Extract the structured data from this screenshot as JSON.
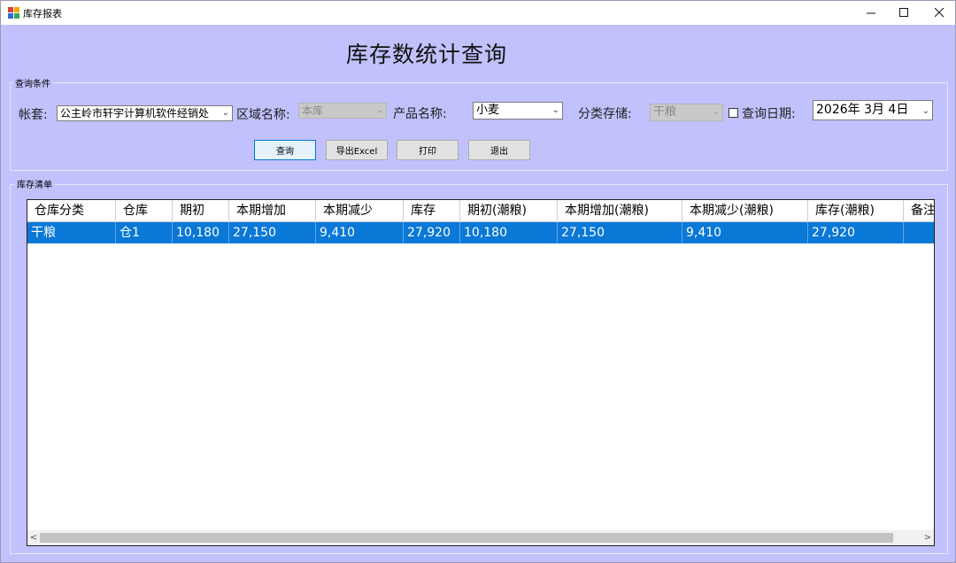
{
  "window": {
    "title": "库存报表"
  },
  "heading": "库存数统计查询",
  "query_group": {
    "label": "查询条件",
    "account_label": "帐套:",
    "account_value": "公主岭市轩宇计算机软件经销处",
    "region_label": "区域名称:",
    "region_value": "本库",
    "product_label": "产品名称:",
    "product_value": "小麦",
    "category_label": "分类存储:",
    "category_value": "干粮",
    "date_label": "查询日期:",
    "date_value": "2026年 3月 4日"
  },
  "buttons": {
    "query": "查询",
    "export": "导出Excel",
    "print": "打印",
    "exit": "退出"
  },
  "list_group": {
    "label": "库存清单"
  },
  "table": {
    "columns": [
      "仓库分类",
      "仓库",
      "期初",
      "本期增加",
      "本期减少",
      "库存",
      "期初(潮粮)",
      "本期增加(潮粮)",
      "本期减少(潮粮)",
      "库存(潮粮)",
      "备注"
    ],
    "rows": [
      [
        "干粮",
        "仓1",
        "10,180",
        "27,150",
        "9,410",
        "27,920",
        "10,180",
        "27,150",
        "9,410",
        "27,920",
        ""
      ]
    ]
  },
  "colors": {
    "window_bg": "#c1c1fd",
    "selection": "#0a78d7"
  },
  "icons": [
    "app-icon",
    "minimize-icon",
    "maximize-icon",
    "close-icon",
    "dropdown-arrow-icon",
    "scroll-left-icon",
    "scroll-right-icon"
  ]
}
